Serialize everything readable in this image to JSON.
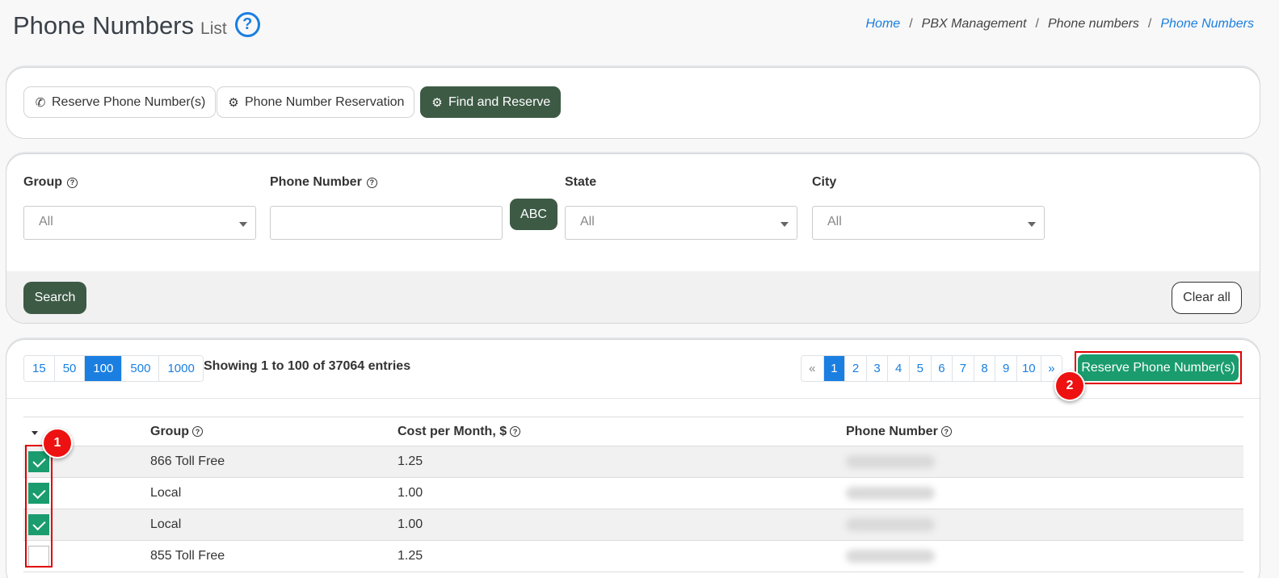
{
  "header": {
    "title": "Phone Numbers",
    "subtitle": "List",
    "help_icon": "question-circle-icon"
  },
  "breadcrumb": [
    {
      "label": "Home",
      "link": true
    },
    {
      "label": "PBX Management",
      "link": false
    },
    {
      "label": "Phone numbers",
      "link": false
    },
    {
      "label": "Phone Numbers",
      "link": true
    }
  ],
  "tabs": [
    {
      "label": "Reserve Phone Number(s)",
      "icon": "phone-icon",
      "active": false
    },
    {
      "label": "Phone Number Reservation",
      "icon": "gears-icon",
      "active": false
    },
    {
      "label": "Find and Reserve",
      "icon": "gears-icon",
      "active": true
    }
  ],
  "filters": {
    "group": {
      "label": "Group",
      "value": "All"
    },
    "phone_number": {
      "label": "Phone Number",
      "value": ""
    },
    "abc_button": "ABC",
    "state": {
      "label": "State",
      "value": "All"
    },
    "city": {
      "label": "City",
      "value": "All"
    },
    "search_button": "Search",
    "clear_button": "Clear all"
  },
  "listing": {
    "page_sizes": [
      "15",
      "50",
      "100",
      "500",
      "1000"
    ],
    "active_page_size": "100",
    "showing_text": "Showing 1 to 100 of 37064 entries",
    "pagination": [
      "«",
      "1",
      "2",
      "3",
      "4",
      "5",
      "6",
      "7",
      "8",
      "9",
      "10",
      "»"
    ],
    "active_page": "1",
    "reserve_button": "Reserve Phone Number(s)"
  },
  "annotations": {
    "badge1": "1",
    "badge2": "2"
  },
  "table": {
    "columns": [
      "Group",
      "Cost per Month, $",
      "Phone Number"
    ],
    "rows": [
      {
        "checked": true,
        "group": "866 Toll Free",
        "cost": "1.25",
        "phone": ""
      },
      {
        "checked": true,
        "group": "Local",
        "cost": "1.00",
        "phone": ""
      },
      {
        "checked": true,
        "group": "Local",
        "cost": "1.00",
        "phone": ""
      },
      {
        "checked": false,
        "group": "855 Toll Free",
        "cost": "1.25",
        "phone": ""
      }
    ]
  },
  "colors": {
    "primary_dark": "#3d5a45",
    "link_blue": "#1a7fe0",
    "success_green": "#1a9c6e",
    "annotation_red": "#e00000"
  }
}
